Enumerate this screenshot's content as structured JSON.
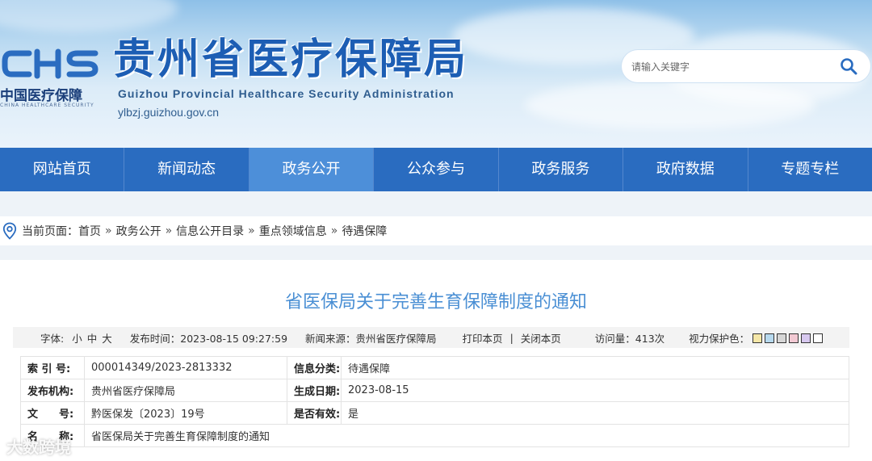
{
  "header": {
    "logo_mark": "CHS",
    "logo_cn": "中国医疗保障",
    "logo_en": "CHINA HEALTHCARE SECURITY",
    "site_title": "贵州省医疗保障局",
    "site_title_en": "Guizhou Provincial Healthcare Security Administration",
    "site_url": "ylbzj.guizhou.gov.cn",
    "search": {
      "placeholder": "请输入关键字",
      "icon": "search-icon"
    }
  },
  "nav": {
    "items": [
      {
        "label": "网站首页"
      },
      {
        "label": "新闻动态"
      },
      {
        "label": "政务公开",
        "active": true
      },
      {
        "label": "公众参与"
      },
      {
        "label": "政务服务"
      },
      {
        "label": "政府数据"
      },
      {
        "label": "专题专栏"
      }
    ]
  },
  "breadcrumb": {
    "prefix": "当前页面：",
    "separator": "»",
    "items": [
      "首页",
      "政务公开",
      "信息公开目录",
      "重点领域信息",
      "待遇保障"
    ]
  },
  "article": {
    "title": "省医保局关于完善生育保障制度的通知",
    "meta": {
      "font_label": "字体:",
      "font_small": "小",
      "font_medium": "中",
      "font_large": "大",
      "publish_time": "发布时间：2023-08-15 09:27:59",
      "source": "新闻来源：贵州省医疗保障局",
      "print": "打印本页",
      "divider": "|",
      "close": "关闭本页",
      "views": "访问量：413次",
      "eye_care": "视力保护色：",
      "eye_colors": [
        "#f5e7a8",
        "#b7d9ee",
        "#d6d6d6",
        "#f2c9d3",
        "#d7c8ef",
        "#ffffff"
      ]
    },
    "info": {
      "index_label": "索 引 号:",
      "index_value": "000014349/2023-2813332",
      "category_label": "信息分类:",
      "category_value": "待遇保障",
      "org_label": "发布机构:",
      "org_value": "贵州省医疗保障局",
      "date_label": "生成日期:",
      "date_value": "2023-08-15",
      "doc_label": "文　　号:",
      "doc_value": "黔医保发〔2023〕19号",
      "valid_label": "是否有效:",
      "valid_value": "是",
      "name_label": "名　　称:",
      "name_value": "省医保局关于完善生育保障制度的通知"
    }
  },
  "watermark": "大数跨境",
  "colors": {
    "brand_blue": "#2a6cc0",
    "nav_active": "#4d8fd9",
    "title_blue": "#4a8fd4"
  }
}
